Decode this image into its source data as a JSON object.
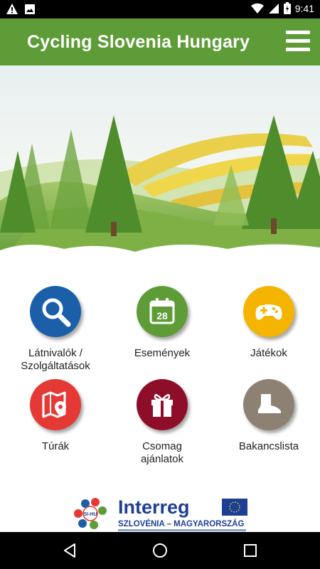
{
  "status_bar": {
    "time": "9:41",
    "icons": [
      "warning-icon",
      "photo-icon",
      "wifi-icon",
      "signal-icon",
      "battery-icon"
    ]
  },
  "app_bar": {
    "title": "Cycling Slovenia Hungary",
    "menu_icon": "hamburger-menu-icon"
  },
  "menu": {
    "items": [
      {
        "label": "Látnivalók / \nSzolgáltatások",
        "icon": "search-icon",
        "color": "#1b5fa8"
      },
      {
        "label": "Események",
        "icon": "calendar-icon",
        "calendar_day": "28",
        "color": "#5e9c37"
      },
      {
        "label": "Játékok",
        "icon": "gamepad-icon",
        "color": "#f4b400"
      },
      {
        "label": "Túrák",
        "icon": "map-pin-icon",
        "color": "#e53935"
      },
      {
        "label": "Csomag\najánlatok",
        "icon": "gift-icon",
        "color": "#8e0e2a"
      },
      {
        "label": "Bakancslista",
        "icon": "boot-icon",
        "color": "#8c8172"
      }
    ]
  },
  "footer": {
    "logo_badge": "SI-HU",
    "program_name": "Interreg",
    "program_region": "SZLOVÉNIA – MAGYARORSZÁG"
  },
  "colors": {
    "app_bar": "#5e9c37",
    "interreg_blue": "#1d3f94",
    "eu_flag": "#1d3f94"
  }
}
